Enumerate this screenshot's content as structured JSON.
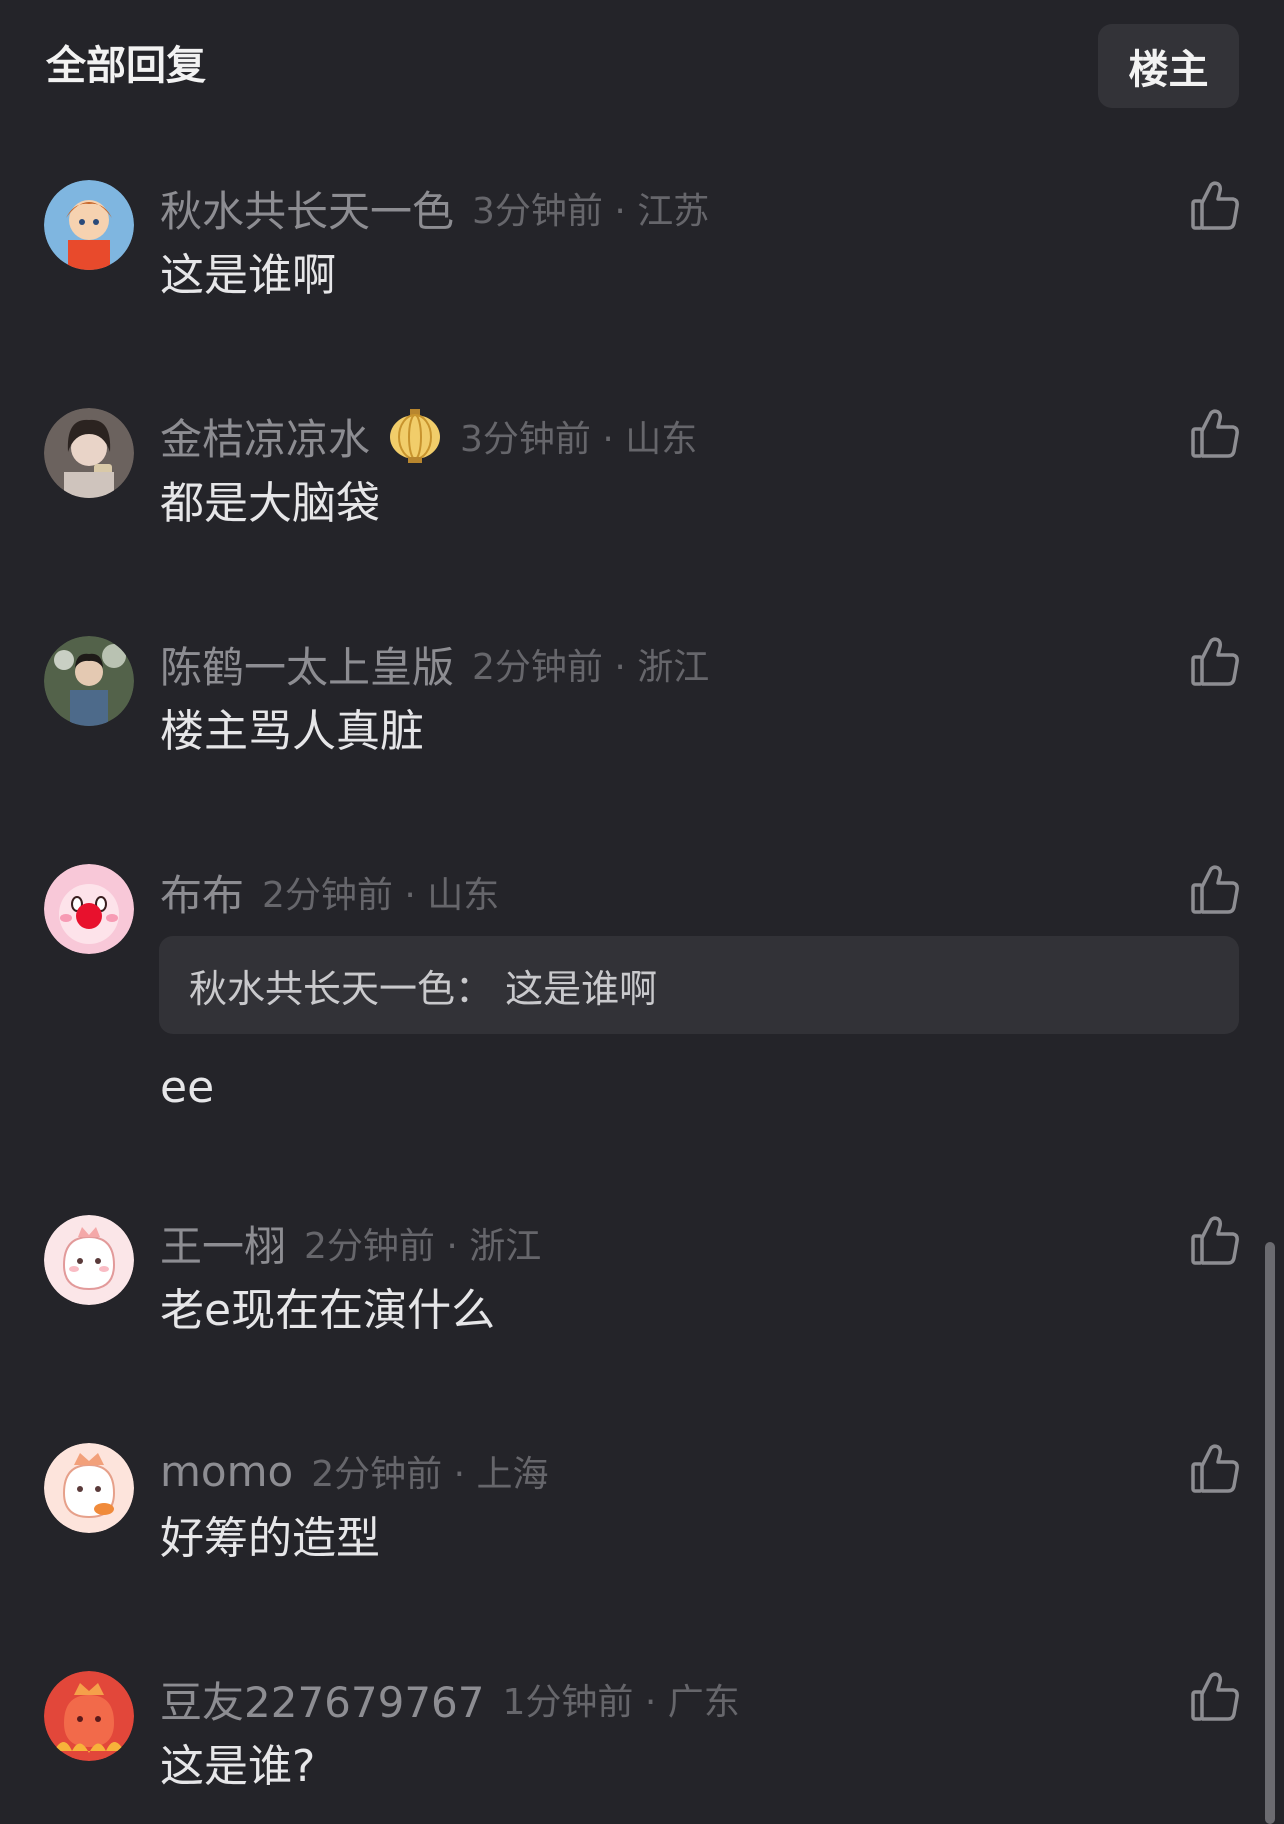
{
  "header": {
    "title": "全部回复",
    "op_button": "楼主"
  },
  "comments": [
    {
      "username": "秋水共长天一色",
      "time": "3分钟前",
      "location": "江苏",
      "text": "这是谁啊"
    },
    {
      "username": "金桔凉凉水",
      "time": "3分钟前",
      "location": "山东",
      "text": "都是大脑袋",
      "badge": "lantern-badge-icon"
    },
    {
      "username": "陈鹤一太上皇版",
      "time": "2分钟前",
      "location": "浙江",
      "text": "楼主骂人真脏"
    },
    {
      "username": "布布",
      "time": "2分钟前",
      "location": "山东",
      "quote": "秋水共长天一色：  这是谁啊",
      "text": "ee"
    },
    {
      "username": "王一栩",
      "time": "2分钟前",
      "location": "浙江",
      "text": "老e现在在演什么"
    },
    {
      "username": "momo",
      "time": "2分钟前",
      "location": "上海",
      "text": "好筹的造型"
    },
    {
      "username": "豆友227679767",
      "time": "1分钟前",
      "location": "广东",
      "text": "这是谁?"
    }
  ],
  "colors": {
    "background": "#242429",
    "text_primary": "#e6e6e8",
    "text_secondary": "#8d8d92",
    "text_muted": "#66666b",
    "surface": "#333338"
  },
  "icons": {
    "like": "thumbs-up-icon"
  }
}
